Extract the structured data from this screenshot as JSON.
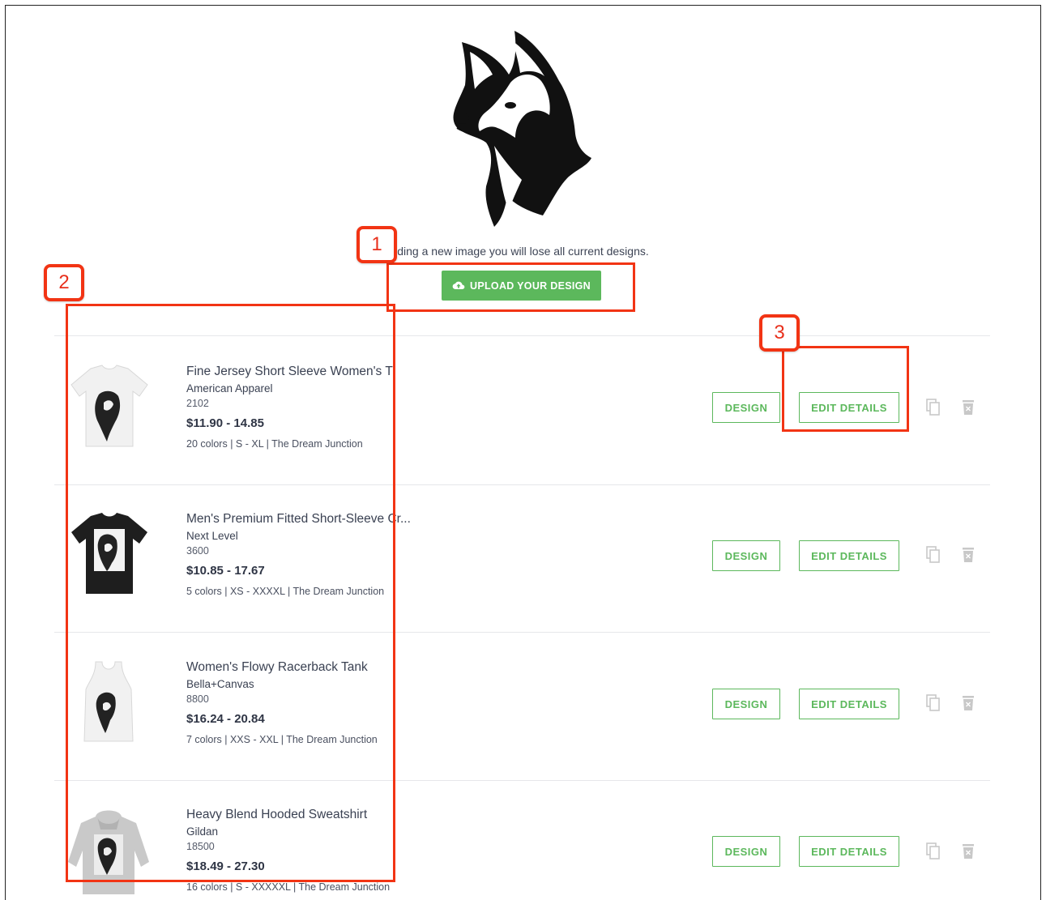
{
  "notice": {
    "text": "ding a new image you will lose all current designs."
  },
  "upload": {
    "label": "UPLOAD YOUR DESIGN",
    "icon": "cloud-upload-icon"
  },
  "products": [
    {
      "title": "Fine Jersey Short Sleeve Women's T",
      "brand": "American Apparel",
      "sku": "2102",
      "price": "$11.90 - 14.85",
      "meta": "20 colors | S - XL | The Dream Junction",
      "garment": "tshirt-white"
    },
    {
      "title": "Men's Premium Fitted Short-Sleeve Cr...",
      "brand": "Next Level",
      "sku": "3600",
      "price": "$10.85 - 17.67",
      "meta": "5 colors | XS - XXXXL | The Dream Junction",
      "garment": "tshirt-black"
    },
    {
      "title": "Women's Flowy Racerback Tank",
      "brand": "Bella+Canvas",
      "sku": "8800",
      "price": "$16.24 - 20.84",
      "meta": "7 colors | XXS - XXL | The Dream Junction",
      "garment": "tank-white"
    },
    {
      "title": "Heavy Blend Hooded Sweatshirt",
      "brand": "Gildan",
      "sku": "18500",
      "price": "$18.49 - 27.30",
      "meta": "16 colors | S - XXXXXL | The Dream Junction",
      "garment": "hoodie-grey"
    }
  ],
  "actions": {
    "design_label": "DESIGN",
    "edit_label": "EDIT DETAILS"
  },
  "callouts": [
    {
      "number": "1"
    },
    {
      "number": "2"
    },
    {
      "number": "3"
    }
  ],
  "colors": {
    "accent_green": "#5cb85c",
    "callout_red": "#f23414"
  }
}
